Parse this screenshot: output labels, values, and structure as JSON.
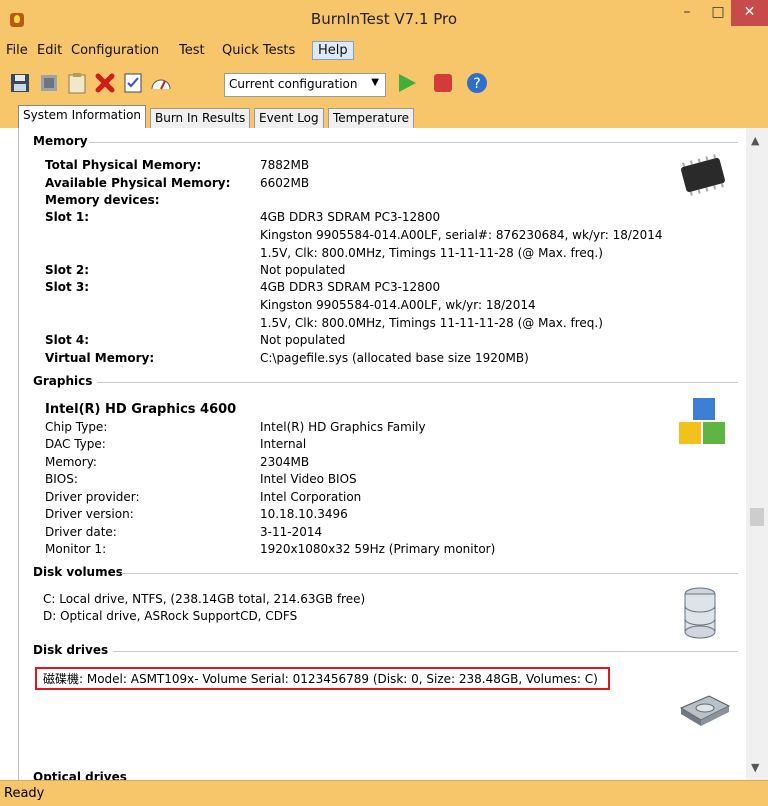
{
  "window": {
    "title": "BurnInTest V7.1 Pro",
    "minimize": "–",
    "maximize": "□",
    "close": "✕"
  },
  "menu": [
    "File",
    "Edit",
    "Configuration",
    "Test",
    "Quick Tests",
    "Help"
  ],
  "toolbar": {
    "config_value": "Current configuration"
  },
  "tabs": [
    "System Information",
    "Burn In Results",
    "Event Log",
    "Temperature"
  ],
  "sections": {
    "memory": {
      "title": "Memory",
      "rows": [
        {
          "label": "Total Physical Memory:",
          "lines": [
            "7882MB"
          ]
        },
        {
          "label": "Available Physical Memory:",
          "lines": [
            "6602MB"
          ]
        },
        {
          "label": "Memory devices:",
          "lines": []
        },
        {
          "label": "Slot 1:",
          "lines": [
            "4GB DDR3 SDRAM PC3-12800",
            "Kingston 9905584-014.A00LF, serial#: 876230684, wk/yr: 18/2014",
            "1.5V, Clk: 800.0MHz, Timings 11-11-11-28 (@ Max. freq.)"
          ]
        },
        {
          "label": "Slot 2:",
          "lines": [
            "Not populated"
          ]
        },
        {
          "label": "Slot 3:",
          "lines": [
            "4GB DDR3 SDRAM PC3-12800",
            "Kingston 9905584-014.A00LF, wk/yr: 18/2014",
            "1.5V, Clk: 800.0MHz, Timings 11-11-11-28 (@ Max. freq.)"
          ]
        },
        {
          "label": "Slot 4:",
          "lines": [
            "Not populated"
          ]
        },
        {
          "label": "Virtual Memory:",
          "lines": [
            "C:\\pagefile.sys (allocated base size 1920MB)"
          ]
        }
      ]
    },
    "graphics": {
      "title": "Graphics",
      "device": "Intel(R) HD Graphics 4600",
      "rows": [
        {
          "label": "Chip Type:",
          "value": "Intel(R) HD Graphics Family"
        },
        {
          "label": "DAC Type:",
          "value": "Internal"
        },
        {
          "label": "Memory:",
          "value": "2304MB"
        },
        {
          "label": "BIOS:",
          "value": "Intel Video BIOS"
        },
        {
          "label": "Driver provider:",
          "value": "Intel Corporation"
        },
        {
          "label": "Driver version:",
          "value": "10.18.10.3496"
        },
        {
          "label": "Driver date:",
          "value": "3-11-2014"
        },
        {
          "label": "Monitor 1:",
          "value": "1920x1080x32 59Hz (Primary monitor)"
        }
      ]
    },
    "disk_volumes": {
      "title": "Disk volumes",
      "lines": [
        "C:  Local drive, NTFS, (238.14GB total, 214.63GB free)",
        "D:  Optical drive, ASRock SupportCD, CDFS"
      ]
    },
    "disk_drives": {
      "title": "Disk drives",
      "line": "磁碟機: Model: ASMT109x- Volume Serial: 0123456789 (Disk: 0, Size: 238.48GB, Volumes: C)"
    },
    "optical": {
      "title": "Optical drives"
    }
  },
  "status": "Ready"
}
